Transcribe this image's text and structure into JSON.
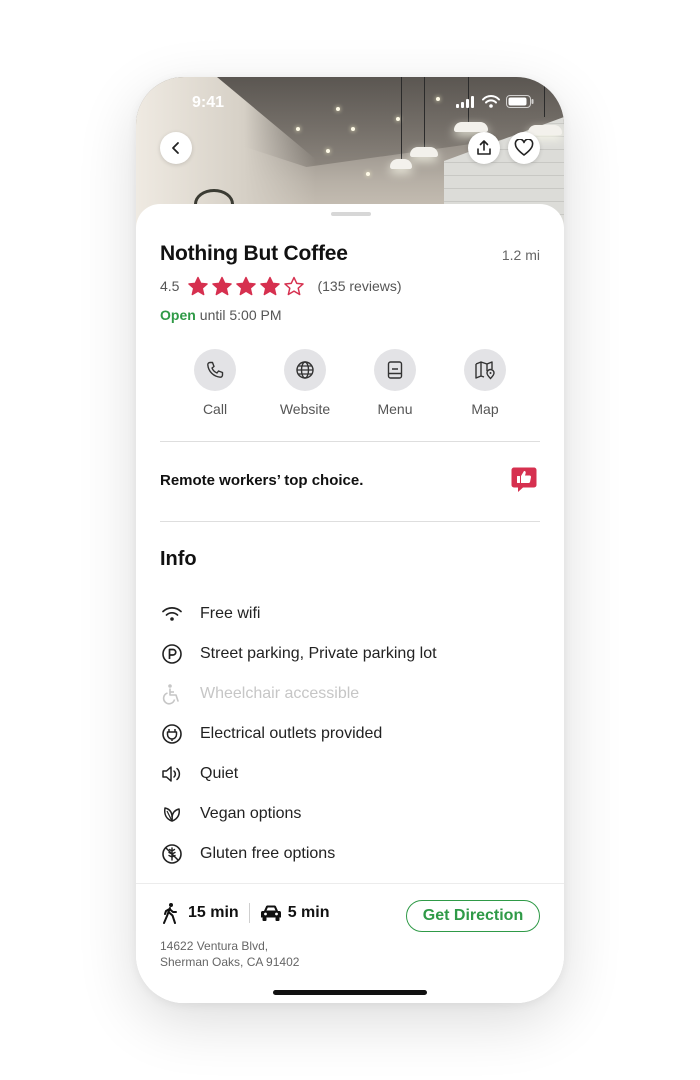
{
  "status_bar": {
    "time": "9:41"
  },
  "place": {
    "name": "Nothing But Coffee",
    "distance": "1.2 mi",
    "rating": "4.5",
    "stars_filled": 4,
    "stars_total": 5,
    "reviews": "(135 reviews)",
    "open_status": "Open",
    "hours": "until 5:00 PM"
  },
  "actions": [
    {
      "label": "Call",
      "icon": "phone-icon"
    },
    {
      "label": "Website",
      "icon": "globe-icon"
    },
    {
      "label": "Menu",
      "icon": "menu-book-icon"
    },
    {
      "label": "Map",
      "icon": "map-icon"
    }
  ],
  "highlight": {
    "text": "Remote workers’ top choice.",
    "icon": "thumbs-up-badge-icon"
  },
  "info": {
    "title": "Info",
    "items": [
      {
        "label": "Free wifi",
        "icon": "wifi-icon",
        "enabled": true
      },
      {
        "label": "Street parking, Private parking lot",
        "icon": "parking-icon",
        "enabled": true
      },
      {
        "label": "Wheelchair accessible",
        "icon": "wheelchair-icon",
        "enabled": false
      },
      {
        "label": "Electrical outlets provided",
        "icon": "outlet-icon",
        "enabled": true
      },
      {
        "label": "Quiet",
        "icon": "speaker-icon",
        "enabled": true
      },
      {
        "label": "Vegan options",
        "icon": "leaf-icon",
        "enabled": true
      },
      {
        "label": "Gluten free options",
        "icon": "gluten-free-icon",
        "enabled": true
      }
    ]
  },
  "footer": {
    "walk_time": "15 min",
    "drive_time": "5 min",
    "address_line1": "14622 Ventura Blvd,",
    "address_line2": "Sherman Oaks, CA 91402",
    "direction_label": "Get Direction"
  },
  "colors": {
    "accent_green": "#2f9a47",
    "star_red": "#d6304f",
    "badge_red": "#d6304f"
  }
}
